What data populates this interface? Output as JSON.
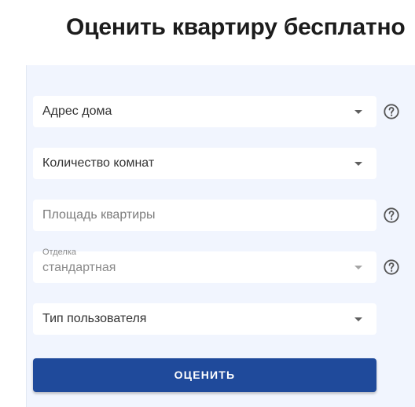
{
  "title": "Оценить квартиру бесплатно",
  "form": {
    "address": {
      "label": "Адрес дома",
      "icon": "chevron-down-icon",
      "help_icon": "help-circle-icon"
    },
    "rooms": {
      "label": "Количество комнат",
      "icon": "chevron-down-icon"
    },
    "area": {
      "placeholder": "Площадь квартиры",
      "help_icon": "help-circle-icon"
    },
    "finish": {
      "label": "Отделка",
      "value": "стандартная",
      "icon": "chevron-down-icon",
      "help_icon": "help-circle-icon"
    },
    "user_type": {
      "label": "Тип пользователя",
      "icon": "chevron-down-icon"
    },
    "submit_label": "ОЦЕНИТЬ"
  },
  "colors": {
    "card_background": "#f1f5fe",
    "button_background": "#1f4a9b",
    "button_text": "#ffffff",
    "title_text": "#1c1c1c"
  }
}
